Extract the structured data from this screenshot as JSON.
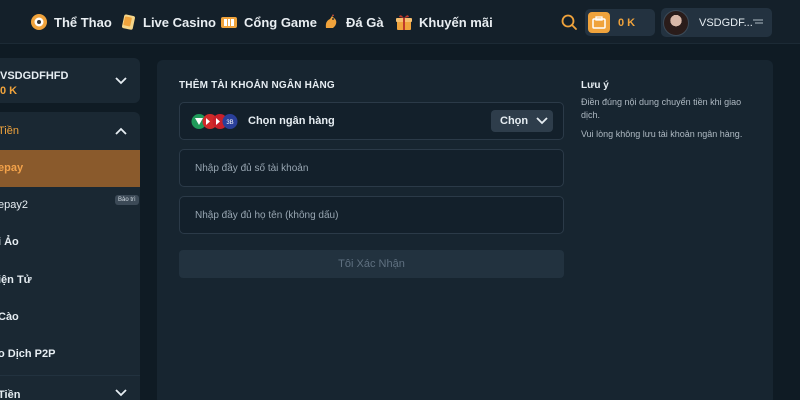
{
  "nav": {
    "items": [
      {
        "label": "Thể Thao",
        "icon": "soccer-ball-icon"
      },
      {
        "label": "Live Casino",
        "icon": "playing-card-icon"
      },
      {
        "label": "Cổng Game",
        "icon": "game-tickets-icon"
      },
      {
        "label": "Đá Gà",
        "icon": "rooster-icon"
      },
      {
        "label": "Khuyến mãi",
        "icon": "gift-icon"
      }
    ],
    "search_icon": "search-icon",
    "balance": "0 K",
    "username": "VSDGDF...",
    "accent": "#f0a33c"
  },
  "sidebar": {
    "account_name": "VSDGDFHFD",
    "account_balance": "0 K",
    "section_title": "Tiền",
    "items": [
      {
        "label": "epay",
        "active": true
      },
      {
        "label": "epay2",
        "badge": "Bảo trì"
      },
      {
        "label": "i Ảo"
      },
      {
        "label": "iện Tử"
      },
      {
        "label": "Cào"
      },
      {
        "label": "o Dịch P2P"
      }
    ],
    "section2_title": "Tiền"
  },
  "form": {
    "title": "THÊM TÀI KHOẢN NGÂN HÀNG",
    "bank_logos": [
      "V",
      "»",
      "»",
      "3B"
    ],
    "bank_label": "Chọn ngân hàng",
    "choose_label": "Chọn",
    "account_number_placeholder": "Nhập đầy đủ số tài khoản",
    "full_name_placeholder": "Nhập đầy đủ họ tên (không dấu)",
    "confirm_label": "Tôi Xác Nhận"
  },
  "note": {
    "title": "Lưu ý",
    "lines": [
      "Điền đúng nội dung chuyển tiền khi giao dịch.",
      "Vui lòng không lưu tài khoản ngân hàng."
    ]
  }
}
